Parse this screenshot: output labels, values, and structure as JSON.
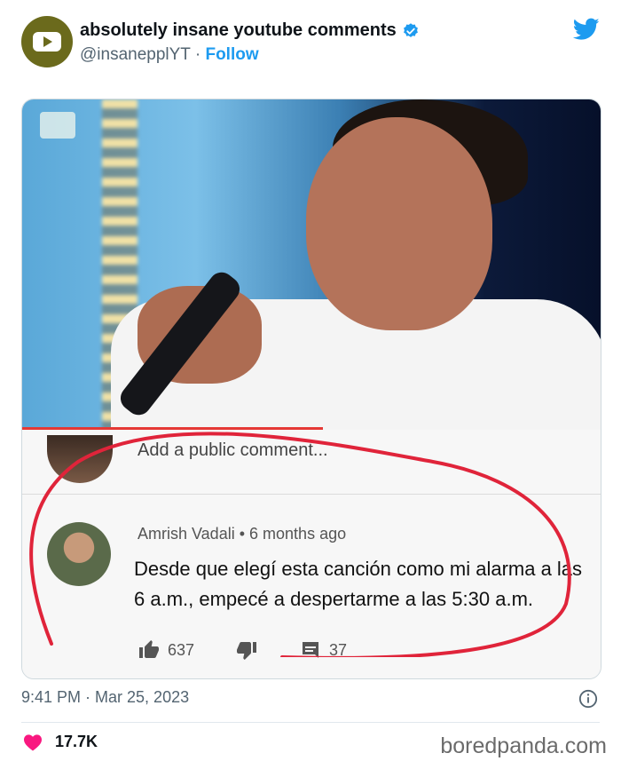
{
  "header": {
    "display_name": "absolutely insane youtube comments",
    "handle": "@insanepplYT",
    "separator": " · ",
    "follow_label": "Follow"
  },
  "media": {
    "add_comment_placeholder": "Add a public comment...",
    "comment": {
      "author": "Amrish Vadali",
      "time": "6 months ago",
      "author_time_separator": " • ",
      "text": "Desde que elegí esta canción como mi alarma a las 6 a.m., empecé a despertarme a las 5:30 a.m.",
      "likes": "637",
      "replies": "37"
    },
    "video_progress_percent": 52
  },
  "footer": {
    "timestamp": "9:41 PM · Mar 25, 2023",
    "likes_count": "17.7K",
    "watermark": "boredpanda.com"
  },
  "colors": {
    "twitter_blue": "#1d9bf0",
    "like_pink": "#f91880",
    "highlight_red": "#e0243a",
    "avatar_olive": "#6b6a1c"
  },
  "icons": [
    "play-logo-icon",
    "verified-badge-icon",
    "twitter-bird-icon",
    "thumbs-up-icon",
    "thumbs-down-icon",
    "reply-icon",
    "info-icon",
    "heart-icon"
  ]
}
